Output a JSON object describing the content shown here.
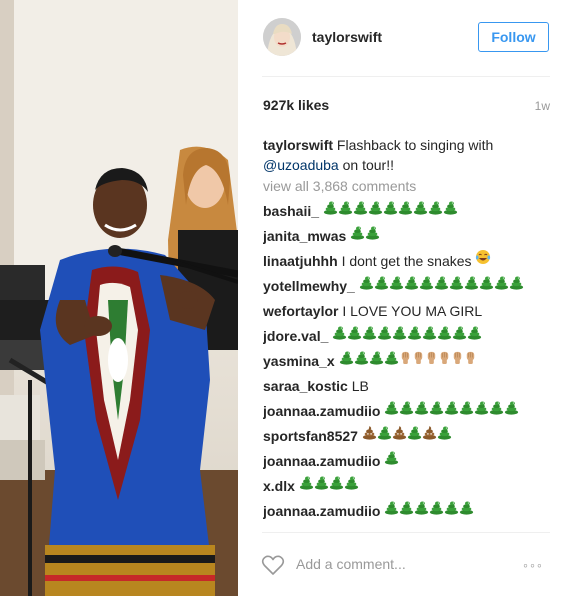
{
  "post": {
    "username": "taylorswift",
    "follow_label": "Follow",
    "likes": "927k likes",
    "age": "1w",
    "caption": {
      "username": "taylorswift",
      "text_before": "Flashback to singing with",
      "mention": "@uzoaduba",
      "text_after": "on tour!!"
    },
    "view_all": "view all 3,868 comments",
    "add_comment_placeholder": "Add a comment...",
    "more_label": "◦◦◦"
  },
  "comments": [
    {
      "user": "bashaii_",
      "text": "",
      "emoji": [
        [
          "snake",
          9
        ]
      ]
    },
    {
      "user": "janita_mwas",
      "text": "",
      "emoji": [
        [
          "snake",
          2
        ]
      ]
    },
    {
      "user": "linaatjuhhh",
      "text": "I dont get the snakes",
      "emoji": [
        [
          "laugh",
          1
        ]
      ]
    },
    {
      "user": "yotellmewhy_",
      "text": "",
      "emoji": [
        [
          "snake",
          11
        ]
      ]
    },
    {
      "user": "wefortaylor",
      "text": "I LOVE YOU MA GIRL",
      "emoji": []
    },
    {
      "user": "jdore.val_",
      "text": "",
      "emoji": [
        [
          "snake",
          10
        ]
      ]
    },
    {
      "user": "yasmina_x",
      "text": "",
      "emoji": [
        [
          "snake",
          4
        ],
        [
          "fingers",
          6
        ]
      ]
    },
    {
      "user": "saraa_kostic",
      "text": "LB",
      "emoji": []
    },
    {
      "user": "joannaa.zamudiio",
      "text": "",
      "emoji": [
        [
          "snake",
          9
        ]
      ]
    },
    {
      "user": "sportsfan8527",
      "text": "",
      "emoji": [
        [
          "poopsnake",
          6
        ]
      ]
    },
    {
      "user": "joannaa.zamudiio",
      "text": "",
      "emoji": [
        [
          "snake",
          1
        ]
      ]
    },
    {
      "user": "x.dlx",
      "text": "",
      "emoji": [
        [
          "snake",
          4
        ]
      ]
    },
    {
      "user": "joannaa.zamudiio",
      "text": "",
      "emoji": [
        [
          "snake",
          6
        ]
      ]
    }
  ],
  "icons": {
    "snake": "snake-emoji",
    "laugh": "tears-of-joy-emoji",
    "fingers": "pinched-fingers-emoji",
    "poop": "pile-of-poo-emoji",
    "heart": "heart-outline-icon"
  },
  "colors": {
    "follow_blue": "#3897f0",
    "mention": "#003569",
    "muted": "#999999",
    "snake_green": "#2e8b2e"
  }
}
